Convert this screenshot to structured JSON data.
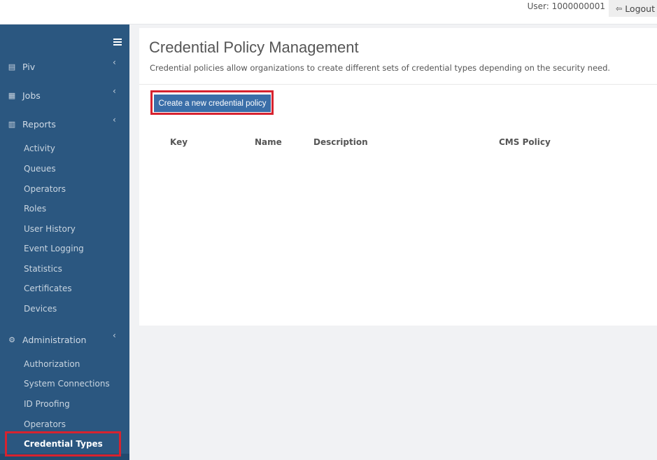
{
  "header": {
    "user_label": "User: 1000000001",
    "logout_label": "Logout"
  },
  "sidebar": {
    "sections": [
      {
        "label": "Piv",
        "icon": "id-card-icon"
      },
      {
        "label": "Jobs",
        "icon": "calendar-icon"
      },
      {
        "label": "Reports",
        "icon": "bar-chart-icon"
      },
      {
        "label": "Administration",
        "icon": "gear-icon"
      }
    ],
    "report_items": [
      "Activity",
      "Queues",
      "Operators",
      "Roles",
      "User History",
      "Event Logging",
      "Statistics",
      "Certificates",
      "Devices"
    ],
    "admin_items": [
      "Authorization",
      "System Connections",
      "ID Proofing",
      "Operators",
      "Credential Types"
    ],
    "active_item": "Credential Types"
  },
  "main": {
    "title": "Credential Policy Management",
    "description": "Credential policies allow organizations to create different sets of credential types depending on the security need.",
    "create_button": "Create a new credential policy",
    "columns": [
      "Key",
      "Name",
      "Description",
      "CMS Policy"
    ]
  },
  "colors": {
    "sidebar_bg": "#2b5780",
    "button_bg": "#3a6ea8",
    "highlight": "#d7232f"
  }
}
